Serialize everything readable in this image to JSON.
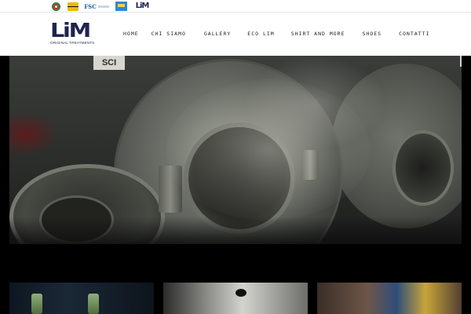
{
  "topbar": {
    "badges": [
      {
        "name": "italian-emblem-icon"
      },
      {
        "name": "made-in-italy-icon"
      },
      {
        "name": "fsc-certification-icon",
        "text": "FSC"
      },
      {
        "name": "chemistry-certification-icon"
      },
      {
        "name": "lim-mini-logo-icon",
        "text": "LiM"
      }
    ]
  },
  "header": {
    "logo_mark": "LiM",
    "logo_tagline": "ORIGINAL TREATMENTS"
  },
  "nav": {
    "items": [
      {
        "label": "HOME"
      },
      {
        "label": "CHI SIAMO"
      },
      {
        "label": "GALLERY"
      },
      {
        "label": "ECO LIM"
      },
      {
        "label": "SHIRT AND MORE"
      },
      {
        "label": "SHOES"
      },
      {
        "label": "CONTATTI"
      }
    ]
  },
  "hero": {
    "machine_label": "SCI"
  },
  "colors": {
    "brand_navy": "#1f2450",
    "page_background": "#000000",
    "header_background": "#ffffff"
  }
}
